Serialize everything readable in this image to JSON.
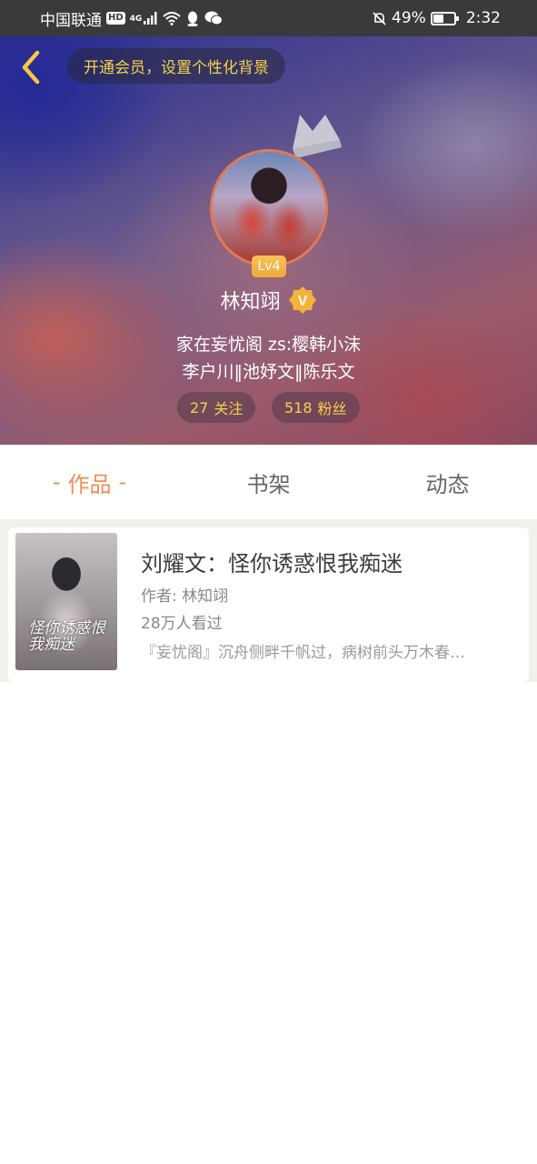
{
  "status_bar": {
    "carrier": "中国联通",
    "hd_badge": "HD",
    "network": "4G",
    "battery_percent": "49%",
    "battery_level": 0.49,
    "time": "2:32",
    "icons": [
      "signal-icon",
      "wifi-icon",
      "qq-icon",
      "wechat-icon",
      "mute-bell-icon",
      "battery-icon"
    ]
  },
  "header": {
    "vip_banner": "开通会员，设置个性化背景",
    "level": "Lv4",
    "username": "林知翊",
    "verified_badge": "V",
    "bio_line1": "家在妄忧阁  zs:樱韩小沫",
    "bio_line2": "李户川‖池妤文‖陈乐文",
    "follow_count": "27",
    "follow_label": "关注",
    "fans_count": "518",
    "fans_label": "粉丝",
    "accent_color": "#f5d24b"
  },
  "tabs": {
    "dash": "-",
    "items": [
      {
        "label": "作品",
        "active": true
      },
      {
        "label": "书架",
        "active": false
      },
      {
        "label": "动态",
        "active": false
      }
    ],
    "active_color": "#f08c5a"
  },
  "works": [
    {
      "cover_text": "怪你诱惑恨我痴迷",
      "title": "刘耀文：怪你诱惑恨我痴迷",
      "author": "作者: 林知翊",
      "views": "28万人看过",
      "description": "『妄忧阁』沉舟侧畔千帆过，病树前头万木春…"
    }
  ]
}
